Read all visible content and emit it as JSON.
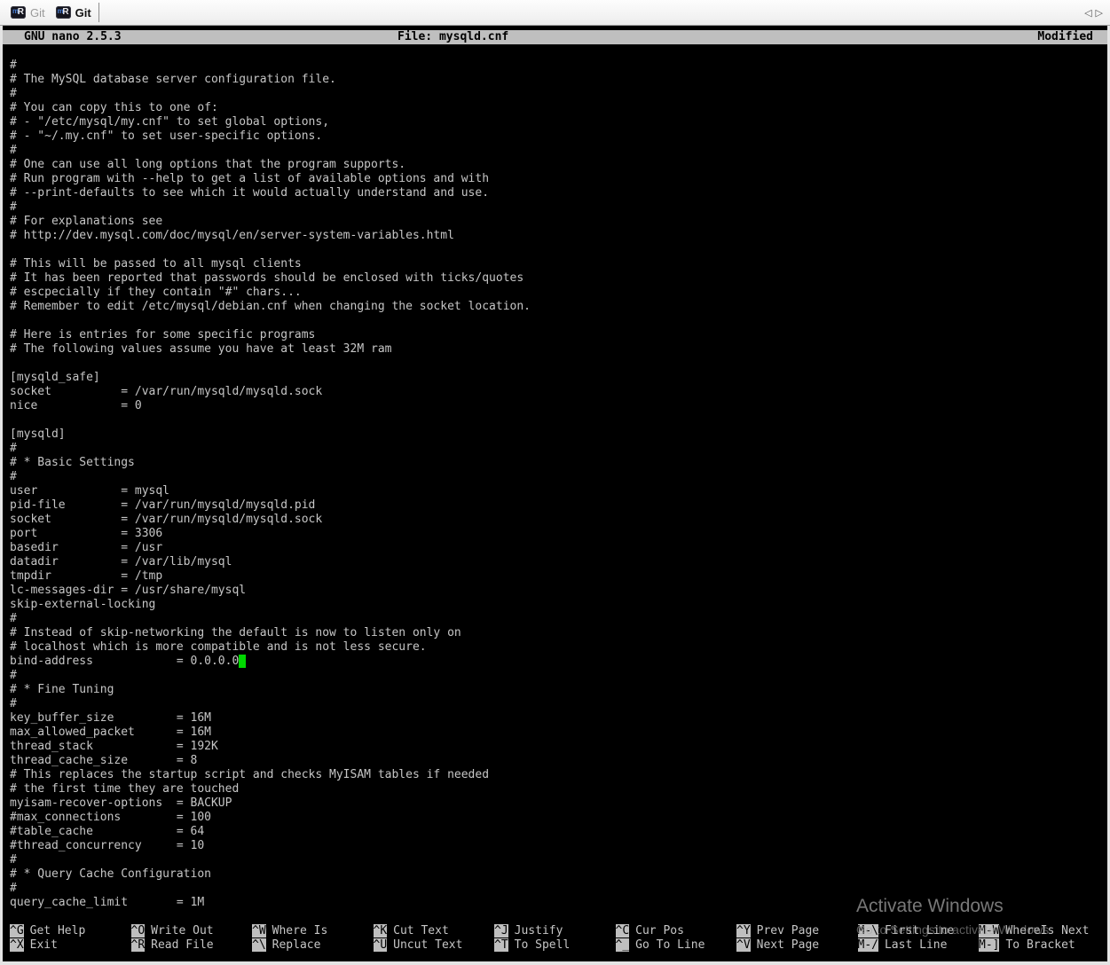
{
  "tab_bar": {
    "tabs": [
      {
        "label": "Git",
        "active": false
      },
      {
        "label": "Git",
        "active": true
      }
    ],
    "scroll_left_icon": "◁",
    "scroll_right_icon": "▷",
    "app_icon": {
      "letter_small": "m",
      "letter_big": "R"
    }
  },
  "nano": {
    "header": {
      "title": "GNU nano 2.5.3",
      "file_label": "File: mysqld.cnf",
      "status": "Modified"
    },
    "editor": {
      "cursor": {
        "line_index": 43,
        "color": "#00d800"
      },
      "lines": [
        "",
        "#",
        "# The MySQL database server configuration file.",
        "#",
        "# You can copy this to one of:",
        "# - \"/etc/mysql/my.cnf\" to set global options,",
        "# - \"~/.my.cnf\" to set user-specific options.",
        "#",
        "# One can use all long options that the program supports.",
        "# Run program with --help to get a list of available options and with",
        "# --print-defaults to see which it would actually understand and use.",
        "#",
        "# For explanations see",
        "# http://dev.mysql.com/doc/mysql/en/server-system-variables.html",
        "",
        "# This will be passed to all mysql clients",
        "# It has been reported that passwords should be enclosed with ticks/quotes",
        "# escpecially if they contain \"#\" chars...",
        "# Remember to edit /etc/mysql/debian.cnf when changing the socket location.",
        "",
        "# Here is entries for some specific programs",
        "# The following values assume you have at least 32M ram",
        "",
        "[mysqld_safe]",
        "socket          = /var/run/mysqld/mysqld.sock",
        "nice            = 0",
        "",
        "[mysqld]",
        "#",
        "# * Basic Settings",
        "#",
        "user            = mysql",
        "pid-file        = /var/run/mysqld/mysqld.pid",
        "socket          = /var/run/mysqld/mysqld.sock",
        "port            = 3306",
        "basedir         = /usr",
        "datadir         = /var/lib/mysql",
        "tmpdir          = /tmp",
        "lc-messages-dir = /usr/share/mysql",
        "skip-external-locking",
        "#",
        "# Instead of skip-networking the default is now to listen only on",
        "# localhost which is more compatible and is not less secure.",
        "bind-address            = 0.0.0.0",
        "#",
        "# * Fine Tuning",
        "#",
        "key_buffer_size         = 16M",
        "max_allowed_packet      = 16M",
        "thread_stack            = 192K",
        "thread_cache_size       = 8",
        "# This replaces the startup script and checks MyISAM tables if needed",
        "# the first time they are touched",
        "myisam-recover-options  = BACKUP",
        "#max_connections        = 100",
        "#table_cache            = 64",
        "#thread_concurrency     = 10",
        "#",
        "# * Query Cache Configuration",
        "#",
        "query_cache_limit       = 1M"
      ]
    },
    "shortcuts": {
      "rows": [
        [
          {
            "key": "^G",
            "label": "Get Help"
          },
          {
            "key": "^O",
            "label": "Write Out"
          },
          {
            "key": "^W",
            "label": "Where Is"
          },
          {
            "key": "^K",
            "label": "Cut Text"
          },
          {
            "key": "^J",
            "label": "Justify"
          },
          {
            "key": "^C",
            "label": "Cur Pos"
          },
          {
            "key": "^Y",
            "label": "Prev Page"
          },
          {
            "key": "M-\\",
            "label": "First Line"
          },
          {
            "key": "M-W",
            "label": "WhereIs Next"
          }
        ],
        [
          {
            "key": "^X",
            "label": "Exit"
          },
          {
            "key": "^R",
            "label": "Read File"
          },
          {
            "key": "^\\",
            "label": "Replace"
          },
          {
            "key": "^U",
            "label": "Uncut Text"
          },
          {
            "key": "^T",
            "label": "To Spell"
          },
          {
            "key": "^_",
            "label": "Go To Line"
          },
          {
            "key": "^V",
            "label": "Next Page"
          },
          {
            "key": "M-/",
            "label": "Last Line"
          },
          {
            "key": "M-]",
            "label": "To Bracket"
          }
        ]
      ]
    }
  },
  "watermark": {
    "line1": "Activate Windows",
    "line2": "Go to Settings to activate Windows."
  },
  "colors": {
    "terminal_background": "#000000",
    "terminal_text": "#c6c6c6",
    "statusbar_background": "#bfbfbf",
    "statusbar_text": "#000000",
    "cursor": "#00d800",
    "watermark_text": "#787878"
  }
}
